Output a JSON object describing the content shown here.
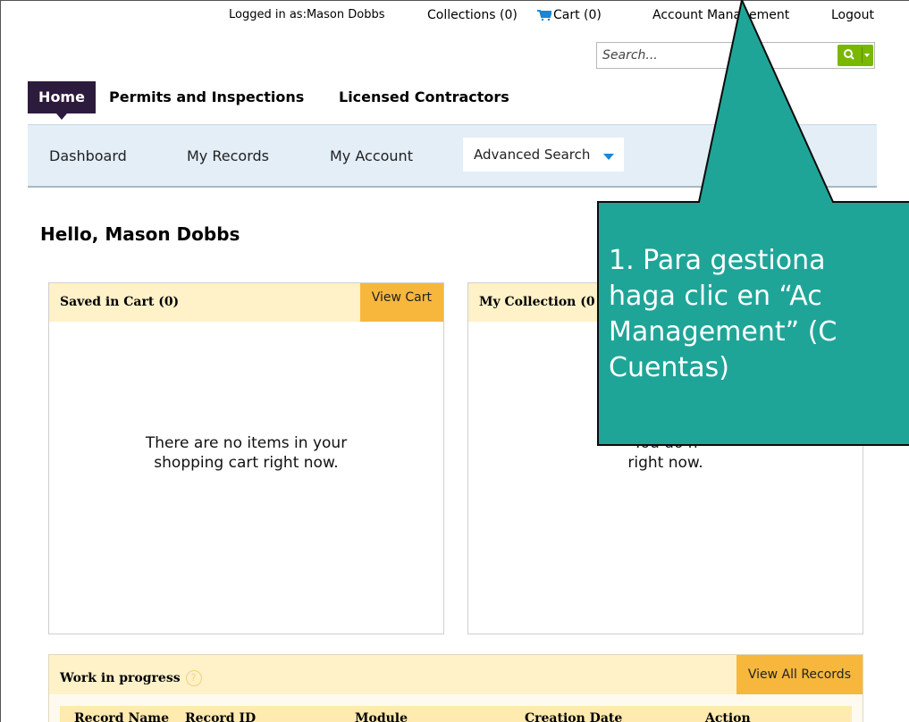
{
  "utility": {
    "logged_in": "Logged in as:Mason Dobbs",
    "collections": "Collections (0)",
    "cart": "Cart (0)",
    "account": "Account Management",
    "logout": "Logout"
  },
  "search": {
    "placeholder": "Search..."
  },
  "main_nav": {
    "home": "Home",
    "permits": "Permits and Inspections",
    "contractors": "Licensed Contractors"
  },
  "sub_nav": {
    "dashboard": "Dashboard",
    "records": "My Records",
    "account": "My Account",
    "advanced": "Advanced Search"
  },
  "greeting": "Hello, Mason Dobbs",
  "cart_panel": {
    "title": "Saved in Cart (0)",
    "button": "View Cart",
    "empty_line1": "There are no items in your",
    "empty_line2": "shopping cart right now."
  },
  "collection_panel": {
    "title": "My Collection (0",
    "empty_line1": "You do n",
    "empty_line2": "right now."
  },
  "wip_panel": {
    "title": "Work in progress",
    "help": "?",
    "button": "View All Records",
    "columns": [
      "Record Name",
      "Record ID",
      "Module",
      "Creation Date",
      "Action"
    ]
  },
  "callout": {
    "lines": [
      "1. Para gestiona",
      "haga clic en “Ac",
      "Management” (C",
      "Cuentas)"
    ],
    "fill": "#1fa598",
    "stroke": "#0b0b0b"
  },
  "colors": {
    "home_tab": "#2d1b3d",
    "search_button": "#7ab800",
    "panel_header": "#fff1c8",
    "panel_button": "#f6b73c",
    "subnav_bg": "#e3eef7",
    "dropdown_caret": "#1a86d6"
  },
  "icons": {
    "cart": "cart-icon",
    "search": "magnifier-icon",
    "dropdown": "caret-down-icon",
    "help": "help-icon"
  }
}
